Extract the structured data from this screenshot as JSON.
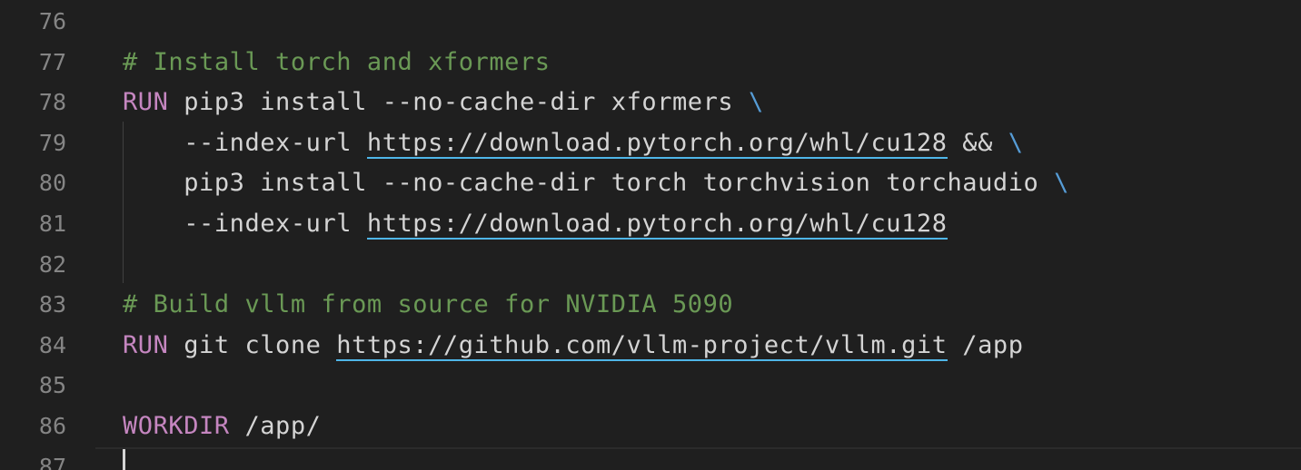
{
  "editor": {
    "lines": [
      {
        "number": "76",
        "parts": []
      },
      {
        "number": "77",
        "parts": [
          {
            "t": "cm",
            "v": "# Install torch and xformers"
          }
        ]
      },
      {
        "number": "78",
        "parts": [
          {
            "t": "kw",
            "v": "RUN"
          },
          {
            "t": "tx",
            "v": " pip3 install --no-cache-dir xformers "
          },
          {
            "t": "bs",
            "v": "\\"
          }
        ]
      },
      {
        "number": "79",
        "parts": [
          {
            "t": "tx",
            "v": "    --index-url "
          },
          {
            "t": "url",
            "v": "https://download.pytorch.org/whl/cu128"
          },
          {
            "t": "tx",
            "v": " && "
          },
          {
            "t": "bs",
            "v": "\\"
          }
        ]
      },
      {
        "number": "80",
        "parts": [
          {
            "t": "tx",
            "v": "    pip3 install --no-cache-dir torch torchvision torchaudio "
          },
          {
            "t": "bs",
            "v": "\\"
          }
        ]
      },
      {
        "number": "81",
        "parts": [
          {
            "t": "tx",
            "v": "    --index-url "
          },
          {
            "t": "url",
            "v": "https://download.pytorch.org/whl/cu128"
          }
        ]
      },
      {
        "number": "82",
        "parts": []
      },
      {
        "number": "83",
        "parts": [
          {
            "t": "cm",
            "v": "# Build vllm from source for NVIDIA 5090"
          }
        ]
      },
      {
        "number": "84",
        "parts": [
          {
            "t": "kw",
            "v": "RUN"
          },
          {
            "t": "tx",
            "v": " git clone "
          },
          {
            "t": "url",
            "v": "https://github.com/vllm-project/vllm.git"
          },
          {
            "t": "tx",
            "v": " /app"
          }
        ]
      },
      {
        "number": "85",
        "parts": []
      },
      {
        "number": "86",
        "parts": [
          {
            "t": "kw",
            "v": "WORKDIR"
          },
          {
            "t": "tx",
            "v": " /app/"
          }
        ]
      },
      {
        "number": "87",
        "parts": []
      }
    ],
    "current_line": "87"
  },
  "colors": {
    "background": "#1f1f1f",
    "keyword": "#c586c0",
    "comment": "#6a9955",
    "text": "#d4d4d4",
    "line_number": "#858585",
    "continuation": "#569cd6",
    "link_underline": "#4fb6e8"
  }
}
